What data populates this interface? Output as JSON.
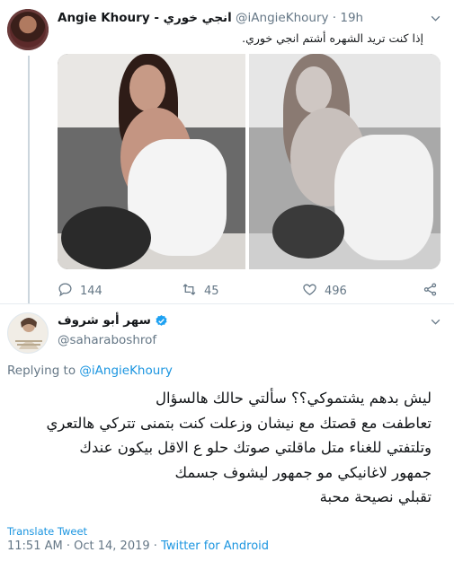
{
  "tweet1": {
    "display_name": "Angie Khoury - انجي خوري",
    "handle": "@iAngieKhoury",
    "time": "19h",
    "text": "إذا كنت تريد الشهره أشتم انجي خوري.",
    "stats": {
      "replies": "144",
      "retweets": "45",
      "likes": "496"
    }
  },
  "tweet2": {
    "display_name": "سهر أبو شروف",
    "handle": "@saharaboshrof",
    "replying_prefix": "Replying to",
    "replying_to": "@iAngieKhoury",
    "lines": [
      "ليش بدهم يشتموكي؟؟ سألتي حالك هالسؤال",
      "تعاطفت مع قصتك مع نيشان وزعلت كنت بتمنى تتركي هالتعري",
      "وتلتفتي للغناء متل ماقلتي صوتك حلو ع الاقل بيكون عندك",
      "جمهور لاغانيكي مو جمهور ليشوف جسمك",
      "تقبلي نصيحة محبة"
    ],
    "translate_label": "Translate Tweet",
    "time": "11:51 AM",
    "date": "Oct 14, 2019",
    "source": "Twitter for Android",
    "meta_sep": "·"
  },
  "icons": {
    "caret": "chevron-down-icon",
    "reply": "reply-icon",
    "retweet": "retweet-icon",
    "like": "heart-icon",
    "share": "share-icon",
    "verified": "verified-badge-icon"
  },
  "colors": {
    "link": "#1b95e0",
    "muted": "#657786",
    "text": "#14171a",
    "verified": "#1da1f2"
  }
}
